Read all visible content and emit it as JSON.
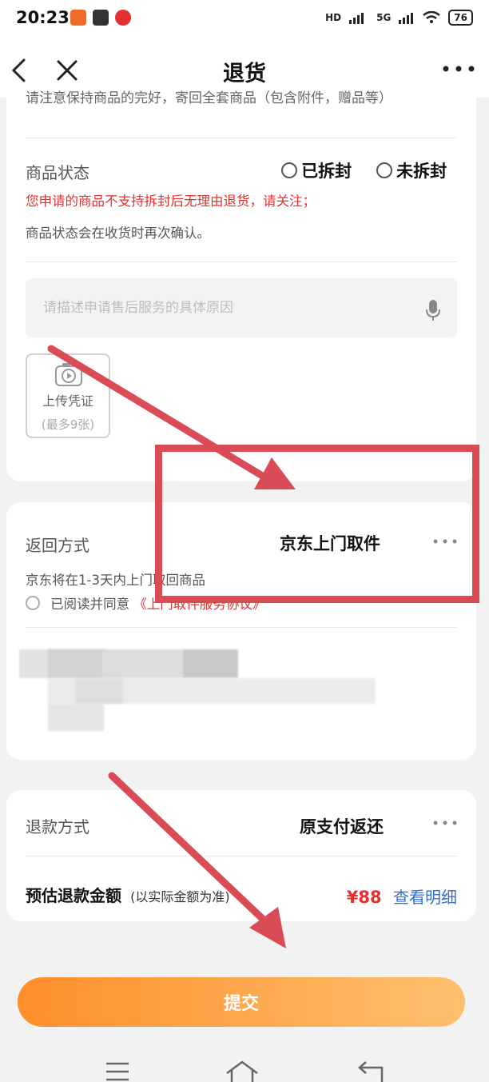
{
  "status_bar": {
    "time": "20:23",
    "signal_label_1": "HD",
    "network_label": "5G",
    "battery": "76"
  },
  "header": {
    "title": "退货"
  },
  "product_section": {
    "cut_text": "请注意保持商品的完好，寄回全套商品（包含附件，赠品等）",
    "status_label": "商品状态",
    "option_opened": "已拆封",
    "option_unopened": "未拆封",
    "warning": "您申请的商品不支持拆封后无理由退货，请关注；",
    "note": "商品状态会在收货时再次确认。",
    "description_placeholder": "请描述申请售后服务的具体原因",
    "upload_label": "上传凭证",
    "upload_sub": "(最多9张)"
  },
  "return_section": {
    "label": "返回方式",
    "value": "京东上门取件",
    "desc": "京东将在1-3天内上门取回商品",
    "agree_prefix": "已阅读并同意",
    "agree_link": "《上门取件服务协议》"
  },
  "refund_section": {
    "label": "退款方式",
    "value": "原支付返还",
    "estimate_label": "预估退款金额",
    "estimate_note": "(以实际金额为准)",
    "price": "¥88",
    "detail_link": "查看明细"
  },
  "submit_label": "提交",
  "colors": {
    "accent_red": "#e43130",
    "link_blue": "#2f6fd6",
    "button_gradient_start": "#fe8f2b",
    "button_gradient_end": "#ffc06e",
    "annotation": "#d94b55"
  }
}
